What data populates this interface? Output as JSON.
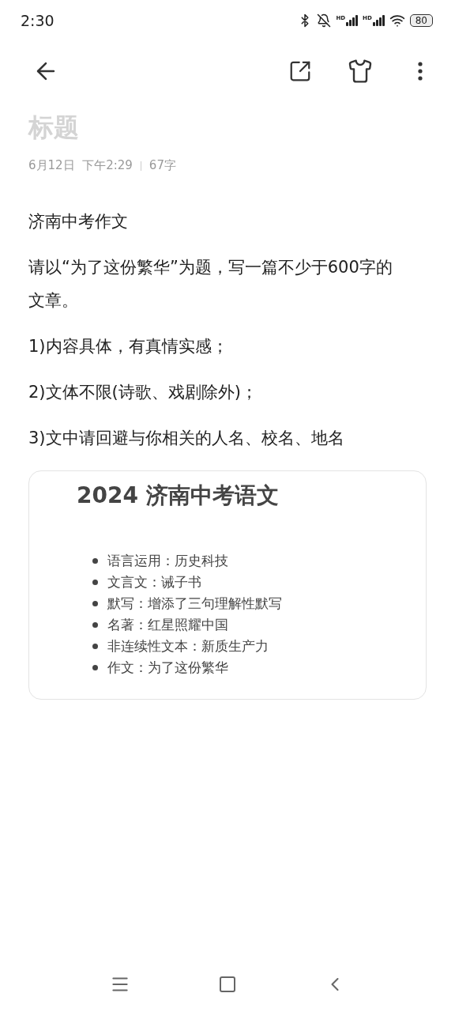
{
  "status_bar": {
    "time": "2:30",
    "signals": [
      {
        "label": "HD"
      },
      {
        "label": "HD"
      }
    ],
    "battery": "80"
  },
  "note": {
    "title_placeholder": "标题",
    "date": "6月12日  下午2:29",
    "word_count": "67字",
    "paragraphs": [
      "济南中考作文",
      "请以“为了这份繁华”为题，写一篇不少于600字的文章。",
      "1)内容具体，有真情实感；",
      "2)文体不限(诗歌、戏剧除外)；",
      "3)文中请回避与你相关的人名、校名、地名"
    ],
    "card": {
      "title": "2024 济南中考语文",
      "items": [
        "语言运用：历史科技",
        "文言文：诫子书",
        "默写：增添了三句理解性默写",
        "名著：红星照耀中国",
        "非连续性文本：新质生产力",
        "作文：为了这份繁华"
      ]
    }
  }
}
